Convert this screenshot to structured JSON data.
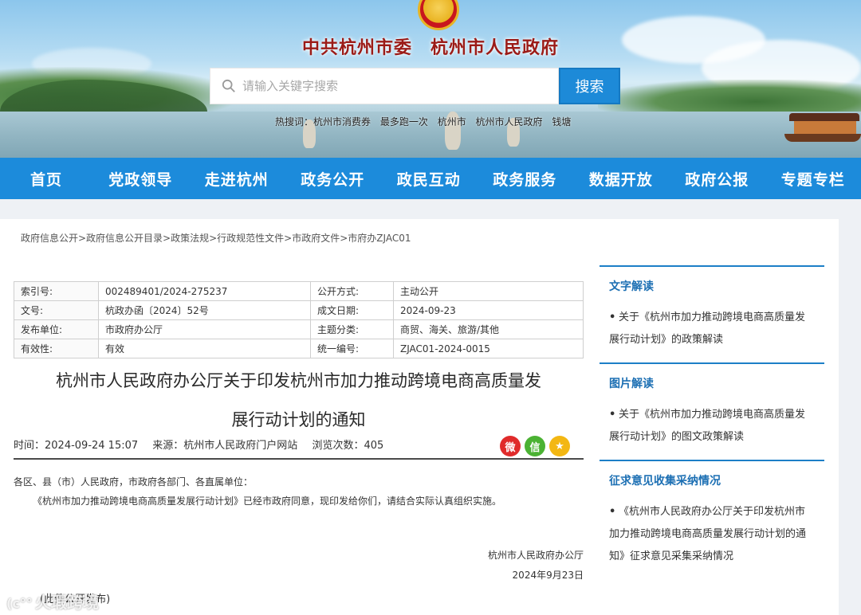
{
  "header": {
    "site_title": "中共杭州市委　杭州市人民政府",
    "search_placeholder": "请输入关键字搜索",
    "search_button": "搜索",
    "hot_words": [
      "热搜词：杭州市消费券",
      "最多跑一次",
      "杭州市",
      "杭州市人民政府",
      "钱塘"
    ]
  },
  "nav": [
    "首页",
    "党政领导",
    "走进杭州",
    "政务公开",
    "政民互动",
    "政务服务",
    "数据开放",
    "政府公报",
    "专题专栏"
  ],
  "breadcrumb": "政府信息公开>政府信息公开目录>政策法规>行政规范性文件>市政府文件>市府办ZJAC01",
  "meta": {
    "rows": [
      {
        "k1": "索引号:",
        "v1": "002489401/2024-275237",
        "k2": "公开方式:",
        "v2": "主动公开"
      },
      {
        "k1": "文号:",
        "v1": "杭政办函〔2024〕52号",
        "k2": "成文日期:",
        "v2": "2024-09-23"
      },
      {
        "k1": "发布单位:",
        "v1": "市政府办公厅",
        "k2": "主题分类:",
        "v2": "商贸、海关、旅游/其他"
      },
      {
        "k1": "有效性:",
        "v1": "有效",
        "k2": "统一编号:",
        "v2": "ZJAC01-2024-0015"
      }
    ]
  },
  "article": {
    "title_line1": "杭州市人民政府办公厅关于印发杭州市加力推动跨境电商高质量发",
    "title_line2": "展行动计划的通知",
    "time": "时间：2024-09-24 15:07",
    "source": "来源：杭州市人民政府门户网站",
    "views": "浏览次数：405",
    "share_icons": {
      "weibo": "微",
      "wechat": "信",
      "favorite": "★"
    },
    "salutation": "各区、县（市）人民政府，市政府各部门、各直属单位：",
    "paragraph": "《杭州市加力推动跨境电商高质量发展行动计划》已经市政府同意，现印发给你们，请结合实际认真组织实施。",
    "sign_org": "杭州市人民政府办公厅",
    "sign_date": "2024年9月23日",
    "footnote": "(此件公开发布)"
  },
  "sidebar": [
    {
      "heading": "文字解读",
      "item": "关于《杭州市加力推动跨境电商高质量发展行动计划》的政策解读"
    },
    {
      "heading": "图片解读",
      "item": "关于《杭州市加力推动跨境电商高质量发展行动计划》的图文政策解读"
    },
    {
      "heading": "征求意见收集采纳情况",
      "item": "《杭州市人民政府办公厅关于印发杭州市加力推动跨境电商高质量发展行动计划的通知》征求意见采集采纳情况"
    }
  ],
  "watermark": "火瑕跨境",
  "colors": {
    "nav_blue": "#1c8bdb",
    "title_red": "#9b1b17",
    "side_accent": "#1c7fc7"
  }
}
